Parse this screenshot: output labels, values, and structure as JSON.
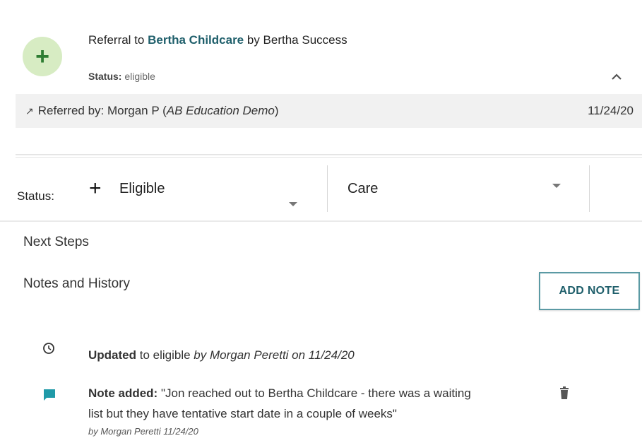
{
  "referral": {
    "title_prefix": "Referral to ",
    "provider": "Bertha Childcare",
    "title_suffix": " by Bertha Success",
    "status_label": "Status:",
    "status_value": " eligible",
    "referred_by_label": "Referred by:  Morgan  P  (",
    "referred_by_org": "AB Education Demo",
    "referred_by_close": ")",
    "date": "11/24/20"
  },
  "status_row": {
    "label": "Status:",
    "status_select": "Eligible",
    "category_select": "Care"
  },
  "sections": {
    "next_steps": "Next Steps",
    "notes_history": "Notes and History",
    "add_note_button": "ADD NOTE"
  },
  "history": {
    "update_bold": "Updated",
    "update_rest": " to eligible ",
    "update_meta": "by Morgan Peretti on 11/24/20",
    "note_bold": "Note added:",
    "note_line1": " \"Jon reached out to Bertha Childcare - there was a waiting",
    "note_line2": "list but they have tentative start date in a couple of weeks\"",
    "note_by": "by Morgan Peretti 11/24/20"
  },
  "colors": {
    "accent": "#1f5f6b",
    "plus_bg": "#d7ecc3",
    "plus_fg": "#2e7d32",
    "note_icon": "#1f9aa8"
  },
  "icons": [
    "plus-icon",
    "chevron-up-icon",
    "arrow-up-right-icon",
    "clock-icon",
    "chat-icon",
    "trash-icon",
    "dropdown-caret-icon"
  ]
}
